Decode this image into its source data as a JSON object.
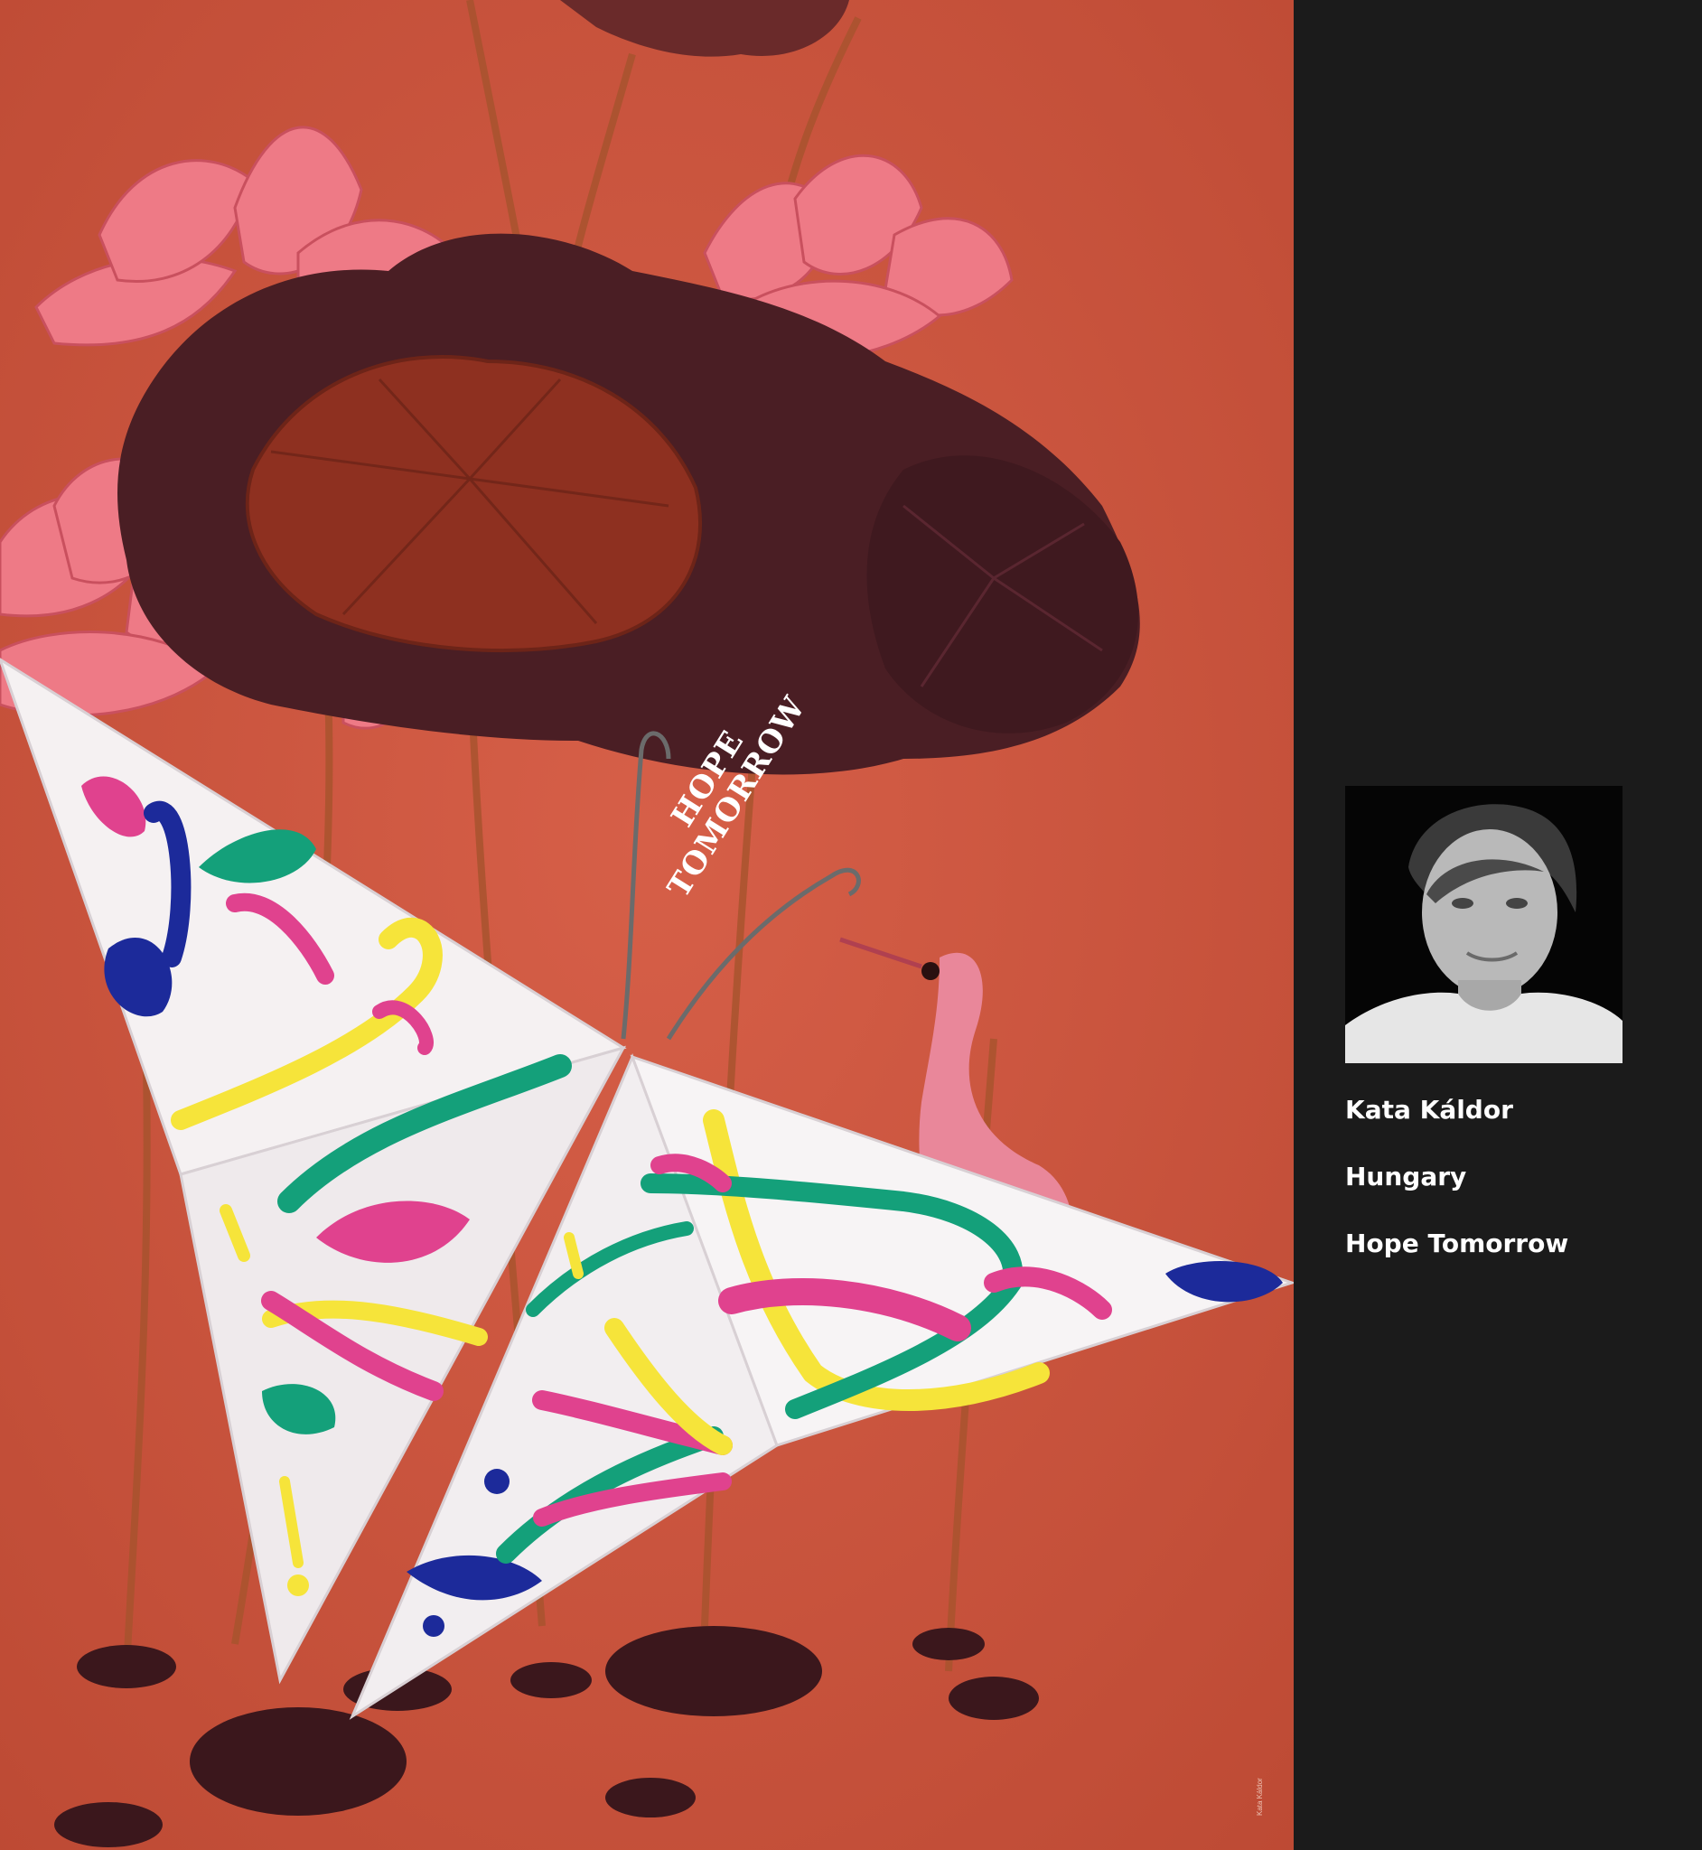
{
  "poster": {
    "title_line_1": "HOPE",
    "title_line_2": "TOMORROW",
    "signature": "Kata Káldor",
    "background_color": "#c9533c"
  },
  "artist": {
    "name": "Kata Káldor",
    "country": "Hungary",
    "work_title": "Hope Tomorrow",
    "photo_icon": "portrait-photo"
  },
  "colors": {
    "panel_bg": "#1b1b1b",
    "paint_blue": "#1c2a9a",
    "paint_green": "#14a07a",
    "paint_pink": "#e0428e",
    "paint_yellow": "#f6e43a"
  }
}
